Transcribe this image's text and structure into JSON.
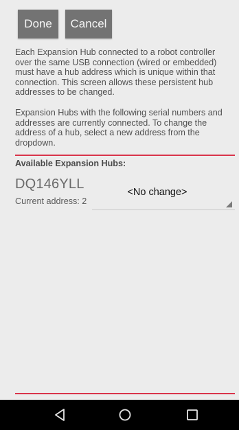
{
  "toolbar": {
    "done_label": "Done",
    "cancel_label": "Cancel"
  },
  "description": {
    "paragraph1": "Each Expansion Hub connected to a robot controller over the same USB connection (wired or embedded) must have a hub address which is unique within that connection. This screen allows these persistent hub addresses to be changed.",
    "paragraph2": "Expansion Hubs with the following serial numbers and addresses are currently connected. To change the address of a hub, select a new address from the dropdown."
  },
  "hubs_section": {
    "label": "Available Expansion Hubs:",
    "hubs": [
      {
        "serial": "DQ146YLL",
        "current_address": "Current address: 2",
        "selected_option": "<No change>"
      }
    ]
  },
  "colors": {
    "accent_red": "#d9344b",
    "button_bg": "#737373",
    "background": "#ececec"
  },
  "navbar": {
    "icons": [
      "back-icon",
      "home-icon",
      "recent-apps-icon"
    ]
  }
}
